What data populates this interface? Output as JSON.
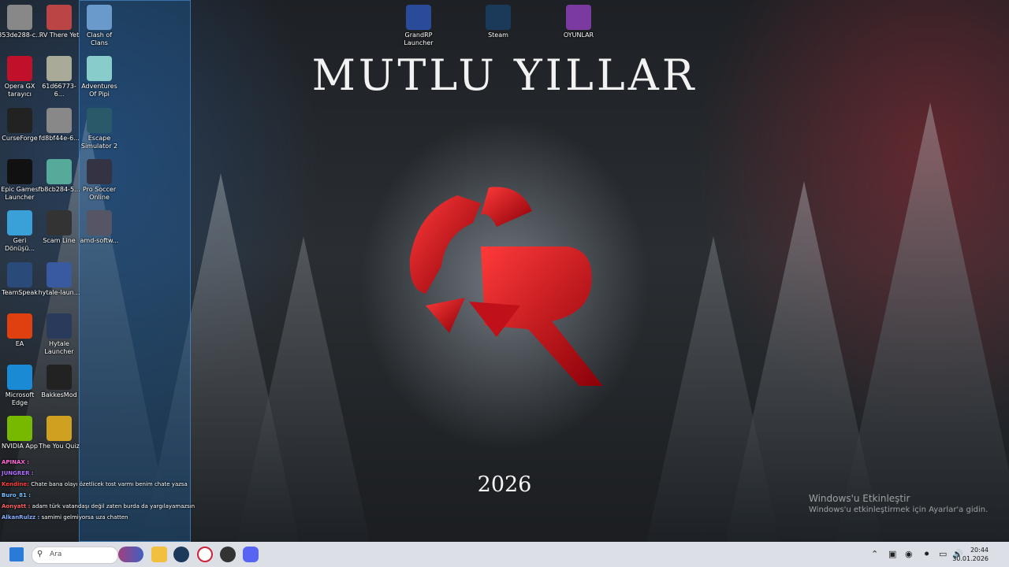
{
  "desktop": {
    "col1": [
      {
        "label": "353de288-c...",
        "icon": "image-file-icon",
        "color": "#888"
      },
      {
        "label": "Opera GX tarayıcı",
        "icon": "opera-gx-icon",
        "color": "#c0102a"
      },
      {
        "label": "CurseForge",
        "icon": "curseforge-icon",
        "color": "#222"
      },
      {
        "label": "Epic Games Launcher",
        "icon": "epic-games-icon",
        "color": "#111"
      },
      {
        "label": "Geri Dönüşü...",
        "icon": "recycle-bin-icon",
        "color": "#3aa0d8"
      },
      {
        "label": "TeamSpeak",
        "icon": "teamspeak-icon",
        "color": "#2a4a7a"
      },
      {
        "label": "EA",
        "icon": "ea-icon",
        "color": "#e04010"
      },
      {
        "label": "Microsoft Edge",
        "icon": "edge-icon",
        "color": "#1a8ad4"
      },
      {
        "label": "NVIDIA App",
        "icon": "nvidia-icon",
        "color": "#76b900"
      }
    ],
    "col2": [
      {
        "label": "RV There Yet",
        "icon": "game-icon",
        "color": "#b44"
      },
      {
        "label": "61d66773-6...",
        "icon": "image-file-icon",
        "color": "#aa9"
      },
      {
        "label": "fd8bf44e-6...",
        "icon": "image-file-icon",
        "color": "#888"
      },
      {
        "label": "fb8cb284-5...",
        "icon": "image-file-icon",
        "color": "#5a9"
      },
      {
        "label": "Scam Line",
        "icon": "game-icon",
        "color": "#333"
      },
      {
        "label": "hytale-laun...",
        "icon": "hytale-icon",
        "color": "#3a5aa0"
      },
      {
        "label": "Hytale Launcher",
        "icon": "hytale-icon",
        "color": "#2a3a5a"
      },
      {
        "label": "BakkesMod",
        "icon": "bakkesmod-icon",
        "color": "#222"
      },
      {
        "label": "The You Quiz",
        "icon": "quiz-icon",
        "color": "#d0a020"
      }
    ],
    "col3": [
      {
        "label": "Clash of Clans",
        "icon": "clash-of-clans-icon",
        "color": "#6a9acc"
      },
      {
        "label": "Adventures Of Pipi",
        "icon": "game-icon",
        "color": "#8cc"
      },
      {
        "label": "Escape Simulator 2",
        "icon": "game-icon",
        "color": "#2a5a6a"
      },
      {
        "label": "Pro Soccer Online",
        "icon": "soccer-icon",
        "color": "#334"
      },
      {
        "label": "amd-softw...",
        "icon": "amd-icon",
        "color": "#556"
      }
    ],
    "top": [
      {
        "label": "GrandRP Launcher",
        "icon": "grandrp-icon",
        "color": "#2a4a9a"
      },
      {
        "label": "Steam",
        "icon": "steam-icon",
        "color": "#1b3a5a"
      },
      {
        "label": "OYUNLAR",
        "icon": "folder-games-icon",
        "color": "#7a3aa0"
      }
    ]
  },
  "wallpaper": {
    "title": "MUTLU YILLAR",
    "year": "2026",
    "accent": "#d0101a"
  },
  "activation": {
    "line1": "Windows'u Etkinleştir",
    "line2": "Windows'u etkinleştirmek için Ayarlar'a gidin."
  },
  "chat": [
    {
      "user": "APINAX :",
      "text": ""
    },
    {
      "user": "JUNGRER :",
      "text": ""
    },
    {
      "user": "Kendine:",
      "text": "Chate bana olayı özetlicek tost varmı benim chate yazsa"
    },
    {
      "user": "Buro_81 :",
      "text": ""
    },
    {
      "user": "Aonyatt :",
      "text": "adam türk vatandaşı değil zaten burda da yargılayamazsın"
    },
    {
      "user": "AlkanRulzz :",
      "text": "samimi gelmiyorsa uza chatten"
    }
  ],
  "taskbar": {
    "search_placeholder": "Ara",
    "time": "20:44",
    "date": "30.01.2026"
  }
}
